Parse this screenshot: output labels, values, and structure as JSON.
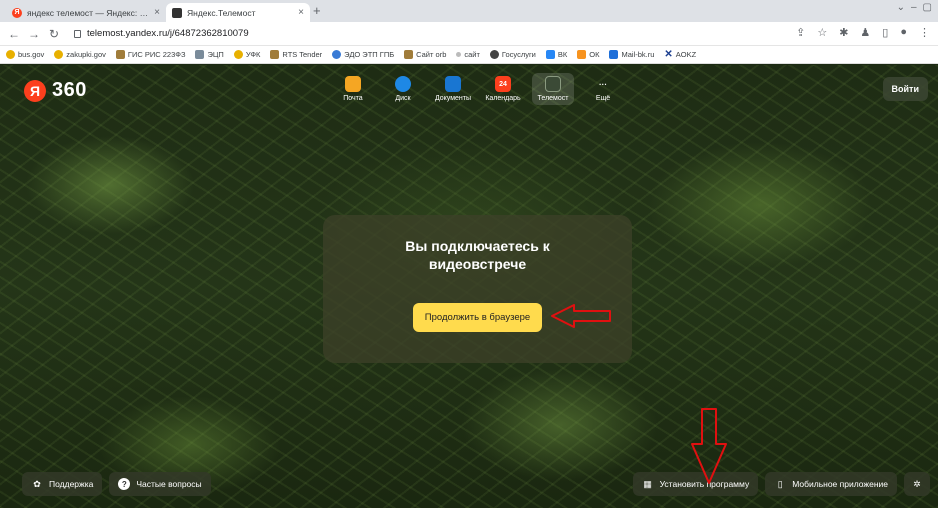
{
  "browser": {
    "tabs": [
      {
        "title": "яндекс телемост — Яндекс: на...",
        "close": "×"
      },
      {
        "title": "Яндекс.Телемост",
        "close": "×"
      }
    ],
    "new_tab": "+",
    "url": "telemost.yandex.ru/j/64872362810079",
    "bookmarks": [
      "bus.gov",
      "zakupki.gov",
      "ГИС РИС 223ФЗ",
      "ЭЦП",
      "УФК",
      "RTS Tender",
      "ЭДО ЭТП ГПБ",
      "Сайт orb",
      "сайт",
      "Госуслуги",
      "ВК",
      "ОК",
      "Mail-bk.ru",
      "AOKZ"
    ]
  },
  "header": {
    "logo_letter": "Я",
    "logo_text": "360",
    "services": [
      {
        "label": "Почта",
        "icon": "mail-icon",
        "color": "#f5a623"
      },
      {
        "label": "Диск",
        "icon": "disk-icon",
        "color": "#1e88e5"
      },
      {
        "label": "Документы",
        "icon": "documents-icon",
        "color": "#1976d2"
      },
      {
        "label": "Календарь",
        "icon": "calendar-icon",
        "color": "#fc3f1d",
        "badge": "24"
      },
      {
        "label": "Телемост",
        "icon": "telemost-icon",
        "color": "#2e3a2a",
        "active": true
      },
      {
        "label": "Ещё",
        "icon": "more-icon",
        "color": "transparent"
      }
    ],
    "login_label": "Войти"
  },
  "card": {
    "title": "Вы подключаетесь к видеовстрече",
    "button_label": "Продолжить в браузере",
    "button_color": "#ffdb4d"
  },
  "footer": {
    "support_label": "Поддержка",
    "faq_label": "Частые вопросы",
    "install_label": "Установить программу",
    "mobile_label": "Мобильное приложение"
  },
  "annotations": {
    "arrow_color": "#e01010"
  }
}
